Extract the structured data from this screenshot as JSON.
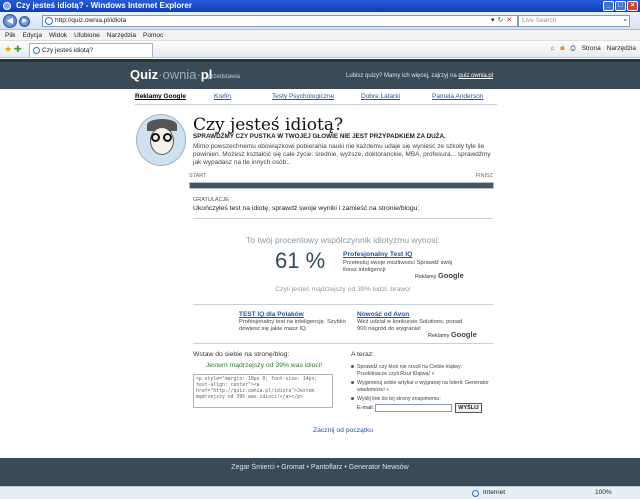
{
  "window": {
    "title": "Czy jesteś idiotą? - Windows Internet Explorer",
    "min": "_",
    "max": "□",
    "close": "×"
  },
  "address": {
    "url": "http://quiz.ownia.pl/idiota",
    "search_placeholder": "Live Search"
  },
  "menu": [
    "Plik",
    "Edycja",
    "Widok",
    "Ulubione",
    "Narzędzia",
    "Pomoc"
  ],
  "tab": {
    "label": "Czy jesteś idiotą?"
  },
  "tools": {
    "page": "Strona",
    "tools": "Narzędzia"
  },
  "site": {
    "logo_a": "Quiz",
    "logo_b": "·ownia·",
    "logo_c": "pl",
    "presents": "przedstawia",
    "header_msg": "Lubisz quizy? Mamy ich więcej, zajrzyj na",
    "header_link": "quiz.ownia.pl"
  },
  "linkbar": {
    "ads": "Reklamy Google",
    "links": [
      "Krefin",
      "Testy Psychologiczne",
      "Dobre Latarki",
      "Pamela Anderson"
    ]
  },
  "quiz": {
    "title": "Czy jesteś idiotą?",
    "subtitle": "SPRAWDŹMY CZY PUSTKA W TWOJEJ GŁOWIE NIE JEST PRZYPADKIEM ZA DUŻA.",
    "description": "Mimo powszechnemu obowiązkowi pobierania nauki nie każdemu udaje się wynieść ze szkoły tyle ile powinien. Możesz kształcić się całe życie: średnie, wyższe, doktoranckie, MBA, profesura... sprawdźmy jak wypadasz na tle innych osób.."
  },
  "progress": {
    "start": "START",
    "finish": "FINISZ",
    "value": 1.0
  },
  "result": {
    "congrats": "GRATULACJE",
    "congrats_text": "Ukończyłeś test na idiotę, sprawdź swoje wyniki i zamieść na stronie/blogu:",
    "score_intro": "To twój procentowy współczynnik idiotyzmu wynosi:",
    "score": "61 %",
    "smarter": "Czyli jesteś mądrzejszy od 39% ludzi, brawo!"
  },
  "ads": {
    "pro_title": "Profesjonalny Test IQ",
    "pro_desc": "Przetestuj swoje możliwości Sprawdź swój iloraz inteligencji",
    "google_label": "Reklamy",
    "google_brand": "Google",
    "a_title": "TEST IQ dla Polaków",
    "a_desc": "Profesjonalny test na inteligencję. Szybko dowiesz się jakie masz IQ.",
    "b_title": "Nowość od Avon",
    "b_desc": "Weź udział w konkursie Solutions, ponad 900 nagród do wygrania!"
  },
  "embed": {
    "label": "Wstaw do siebie na stronę/blog:",
    "preview": "Jestem mądrzejszy od 39% was idioci!",
    "code": "<p style=\"margin: 10px 0; font-size: 14px; text-align: center\"><a href=\"http://quiz.ownia.pl/idiota\">Jestem mądrzejszy od 39% was idioci!</a></p>"
  },
  "also": {
    "title": "A teraz:",
    "items": [
      "Sprawdź czy ktoś nie rzucił na Ciebie klątwy: Przeklinacze czyli Rzut Klątwą! »",
      "Wygeneruj sobie artykuł o wygranej na loterii: Generator wiadomości »",
      "Wyślij link do tej strony znajomemu:"
    ],
    "email_label": "E-mail:",
    "send": "WYŚLIJ"
  },
  "restart": "Zacznij od początku",
  "footer": {
    "links": [
      "Zegar Śmierci",
      "Gromat",
      "Pantoflarz",
      "Generator Newsów"
    ],
    "sep": " • "
  },
  "status": {
    "zone": "Internet",
    "zoom": "100%"
  },
  "colors": {
    "header_bg": "#3a4a57",
    "link": "#2255aa",
    "score": "#2f4a5e",
    "preview": "#2f7a2f"
  },
  "icons": [
    "back-icon",
    "forward-icon",
    "refresh-icon",
    "stop-icon",
    "search-icon",
    "star-icon",
    "add-favorite-icon",
    "home-icon",
    "feed-icon",
    "print-icon",
    "ie-icon"
  ]
}
